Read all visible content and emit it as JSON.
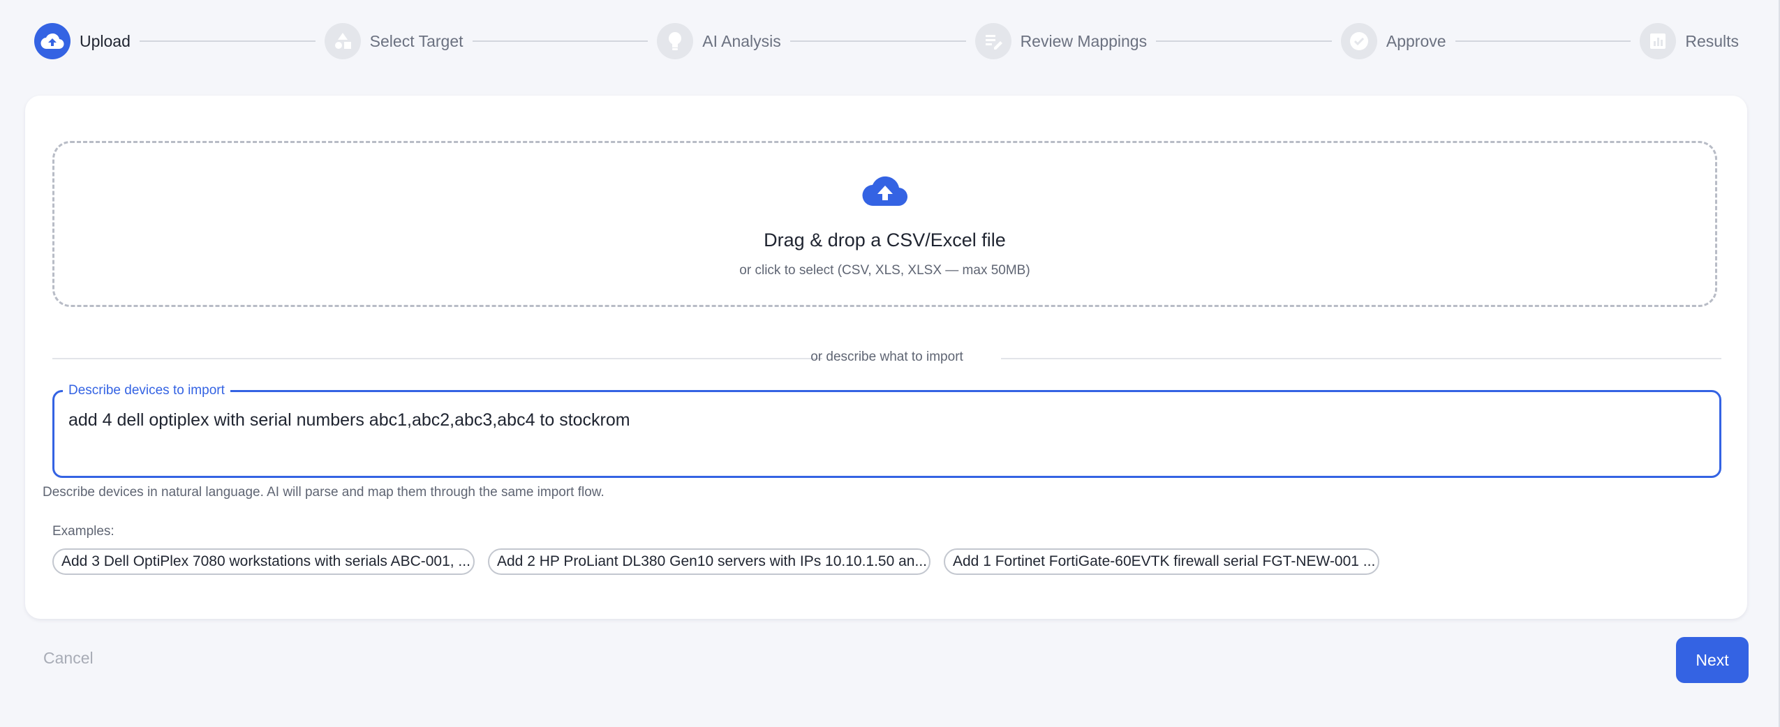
{
  "stepper": {
    "steps": [
      {
        "label": "Upload",
        "icon": "cloud-upload-icon",
        "active": true
      },
      {
        "label": "Select Target",
        "icon": "shapes-icon",
        "active": false
      },
      {
        "label": "AI Analysis",
        "icon": "lightbulb-icon",
        "active": false
      },
      {
        "label": "Review Mappings",
        "icon": "edit-list-icon",
        "active": false
      },
      {
        "label": "Approve",
        "icon": "check-circle-icon",
        "active": false
      },
      {
        "label": "Results",
        "icon": "bar-chart-icon",
        "active": false
      }
    ]
  },
  "upload": {
    "title": "Drag & drop a CSV/Excel file",
    "subtitle": "or click to select (CSV, XLS, XLSX — max 50MB)"
  },
  "divider_text": "or describe what to import",
  "describe": {
    "label": "Describe devices to import",
    "value": "add 4 dell optiplex with serial numbers abc1,abc2,abc3,abc4 to stockrom",
    "helper": "Describe devices in natural language. AI will parse and map them through the same import flow."
  },
  "examples": {
    "label": "Examples:",
    "items": [
      "Add 3 Dell OptiPlex 7080 workstations with serials ABC-001, ...",
      "Add 2 HP ProLiant DL380 Gen10 servers with IPs 10.10.1.50 an...",
      "Add 1 Fortinet FortiGate-60EVTK firewall serial FGT-NEW-001 ..."
    ]
  },
  "actions": {
    "cancel": "Cancel",
    "next": "Next"
  },
  "colors": {
    "accent": "#3463e3",
    "inactive_step": "#e4e6eb",
    "background": "#f5f6fa"
  }
}
